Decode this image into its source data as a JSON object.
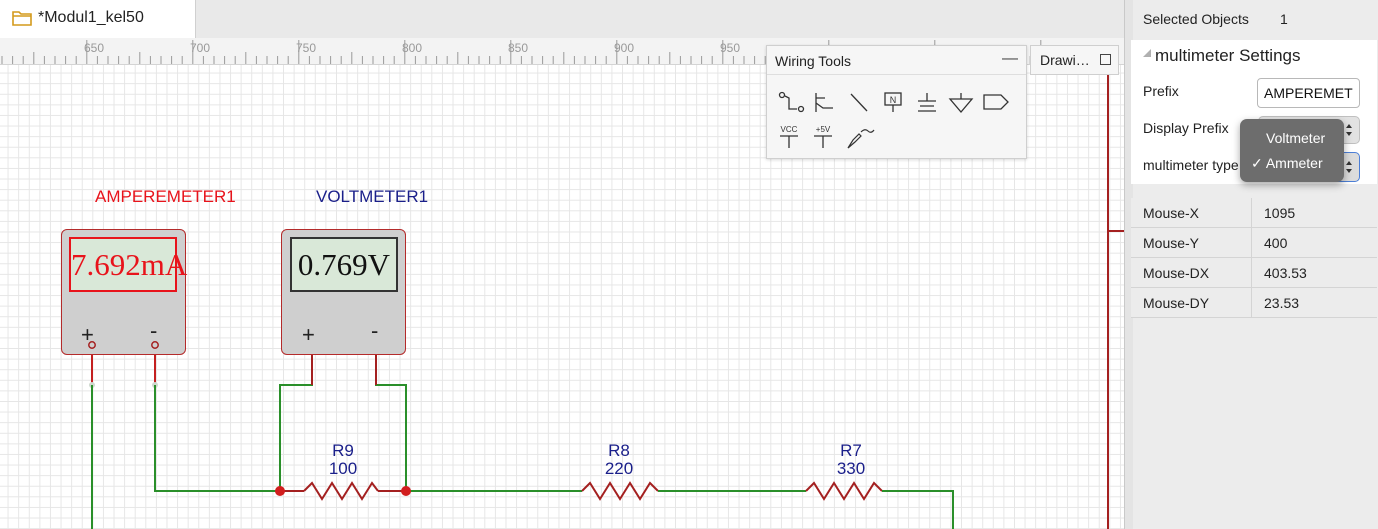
{
  "tab": {
    "title": "*Modul1_kel50"
  },
  "ruler": {
    "labels": [
      "650",
      "700",
      "750",
      "800",
      "850",
      "900",
      "950"
    ]
  },
  "meters": {
    "ammeter": {
      "name": "AMPEREMETER1",
      "reading": "7.692mA",
      "plus": "+",
      "minus": "-",
      "color": "#e8131b"
    },
    "voltmeter": {
      "name": "VOLTMETER1",
      "reading": "0.769V",
      "plus": "+",
      "minus": "-",
      "color": "#1a1f8a"
    }
  },
  "resistors": [
    {
      "name": "R9",
      "value": "100"
    },
    {
      "name": "R8",
      "value": "220"
    },
    {
      "name": "R7",
      "value": "330"
    }
  ],
  "wiring_tools": {
    "title": "Wiring Tools",
    "minimize": "—",
    "tools": [
      "switch-icon",
      "junction-icon",
      "wire-icon",
      "net-label-icon",
      "ground-icon",
      "earth-icon",
      "tag-icon",
      "vcc-icon",
      "plus5v-icon",
      "probe-icon"
    ],
    "vcc_text": "VCC",
    "plus5v_text": "+5V",
    "net_text": "N"
  },
  "drawing_tab": {
    "title": "Drawi…"
  },
  "properties": {
    "selected_label": "Selected Objects",
    "selected_count": "1",
    "section_title": "multimeter Settings",
    "prefix_label": "Prefix",
    "prefix_value": "AMPEREMET",
    "display_prefix_label": "Display Prefix",
    "type_label": "multimeter type",
    "dropdown_options": [
      "Voltmeter",
      "✓ Ammeter"
    ],
    "mouse": [
      {
        "key": "Mouse-X",
        "value": "1095"
      },
      {
        "key": "Mouse-Y",
        "value": "400"
      },
      {
        "key": "Mouse-DX",
        "value": "403.53"
      },
      {
        "key": "Mouse-DY",
        "value": "23.53"
      }
    ]
  },
  "colors": {
    "wire_green": "#2a8f2a",
    "wire_red": "#c42020",
    "resistor": "#a42020",
    "junction": "#d21e1e"
  }
}
